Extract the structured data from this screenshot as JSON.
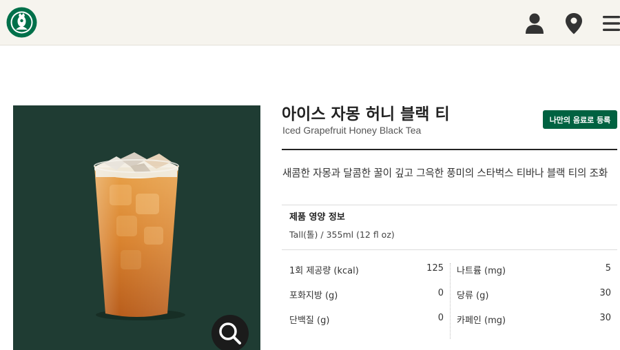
{
  "header": {
    "logo_icon": "starbucks-siren-logo",
    "icons": [
      "user-icon",
      "location-pin-icon",
      "menu-icon"
    ],
    "background": "#f6f4ee"
  },
  "product": {
    "name_kr": "아이스 자몽 허니 블랙 티",
    "name_en": "Iced Grapefruit Honey Black Tea",
    "register_label": "나만의 음료로 등록",
    "description": "새콤한 자몽과 달콤한 꿀이 깊고 그윽한 풍미의 스타벅스 티바나 블랙 티의 조화",
    "image_background": "#1f3c33",
    "zoom_icon": "magnifier-icon"
  },
  "nutrition": {
    "title": "제품 영양 정보",
    "serving": "Tall(톨) / 355ml (12 fl oz)",
    "left": [
      {
        "label": "1회 제공량 (kcal)",
        "value": "125"
      },
      {
        "label": "포화지방 (g)",
        "value": "0"
      },
      {
        "label": "단백질 (g)",
        "value": "0"
      }
    ],
    "right": [
      {
        "label": "나트륨 (mg)",
        "value": "5"
      },
      {
        "label": "당류 (g)",
        "value": "30"
      },
      {
        "label": "카페인 (mg)",
        "value": "30"
      }
    ]
  },
  "colors": {
    "brand_green": "#006241",
    "text": "#222222"
  }
}
